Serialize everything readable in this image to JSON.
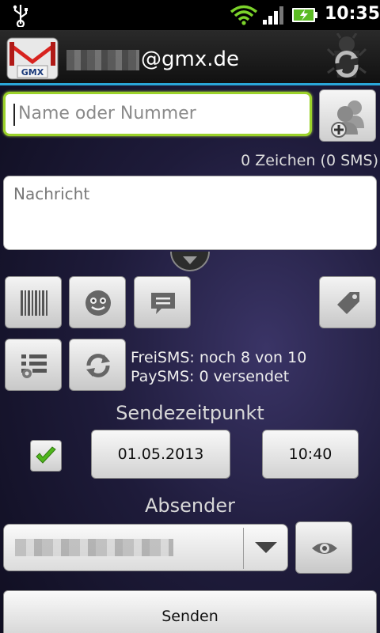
{
  "status_bar": {
    "time": "10:35",
    "icons": [
      "usb-icon",
      "wifi-icon",
      "signal-icon",
      "battery-charging-icon"
    ]
  },
  "title_bar": {
    "logo_text": "GMX",
    "account_domain": "@gmx.de",
    "sync_icon": "sync-icon"
  },
  "compose": {
    "recipient_placeholder": "Name oder Nummer",
    "recipient_value": "",
    "char_count": "0 Zeichen (0 SMS)",
    "message_placeholder": "Nachricht",
    "message_value": ""
  },
  "toolbar": {
    "buttons": [
      "barcode-icon",
      "smiley-icon",
      "message-template-icon",
      "tag-icon",
      "list-icon",
      "refresh-icon"
    ]
  },
  "info": {
    "free_sms": "FreiSMS: noch 8 von 10",
    "pay_sms": "PaySMS: 0 versendet"
  },
  "schedule": {
    "title": "Sendezeitpunkt",
    "enabled": true,
    "date": "01.05.2013",
    "time": "10:40"
  },
  "sender": {
    "title": "Absender",
    "selected_value": "",
    "eye_icon": "eye-icon"
  },
  "send_button": "Senden",
  "colors": {
    "accent_blue": "#2aa6d8",
    "focus_green": "#9bd22a",
    "check_green": "#4fb51c"
  }
}
